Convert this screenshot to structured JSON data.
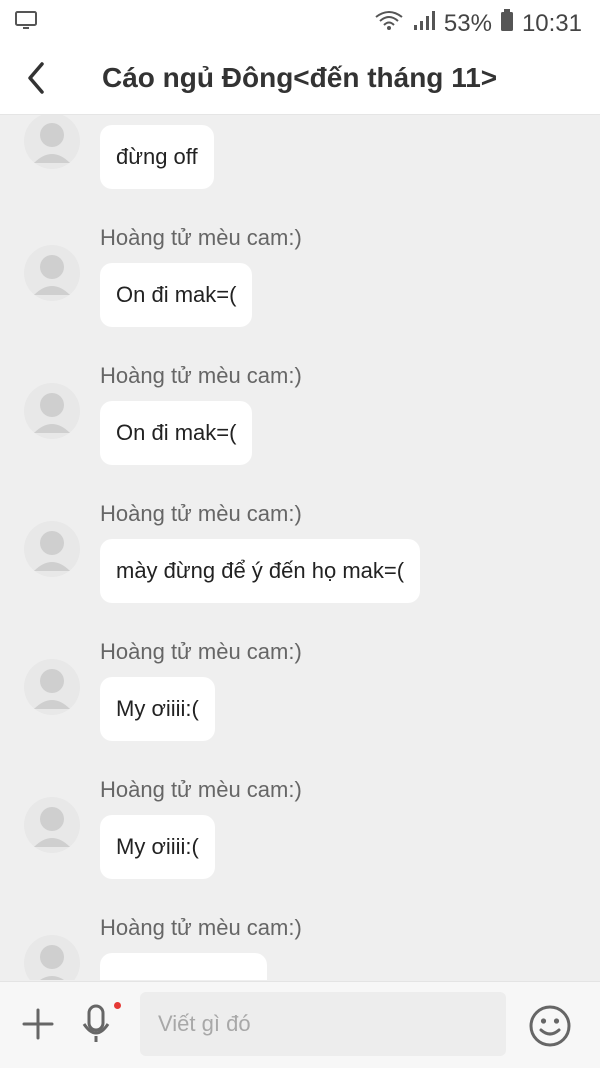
{
  "status_bar": {
    "battery": "53%",
    "time": "10:31",
    "icons": {
      "left": "screen-icon",
      "wifi": "wifi-icon",
      "signal": "signal-icon",
      "battery": "battery-icon"
    }
  },
  "header": {
    "title": "Cáo ngủ Đông<đến tháng 11>",
    "back_icon": "chevron-left-icon"
  },
  "messages": [
    {
      "sender": "",
      "text": "đừng off"
    },
    {
      "sender": "Hoàng tử mèu cam:)",
      "text": "On đi mak=("
    },
    {
      "sender": "Hoàng tử mèu cam:)",
      "text": "On đi mak=("
    },
    {
      "sender": "Hoàng tử mèu cam:)",
      "text": "mày đừng để ý đến họ mak=("
    },
    {
      "sender": "Hoàng tử mèu cam:)",
      "text": "My ơiiii:("
    },
    {
      "sender": "Hoàng tử mèu cam:)",
      "text": "My ơiiii:("
    },
    {
      "sender": "Hoàng tử mèu cam:)",
      "text": ""
    }
  ],
  "composer": {
    "placeholder": "Viết gì đó",
    "icons": {
      "add": "plus-icon",
      "mic": "microphone-icon",
      "emoji": "emoji-icon"
    }
  },
  "colors": {
    "chat_background": "#efefef",
    "bubble": "#ffffff",
    "badge_dot": "#e53935"
  }
}
